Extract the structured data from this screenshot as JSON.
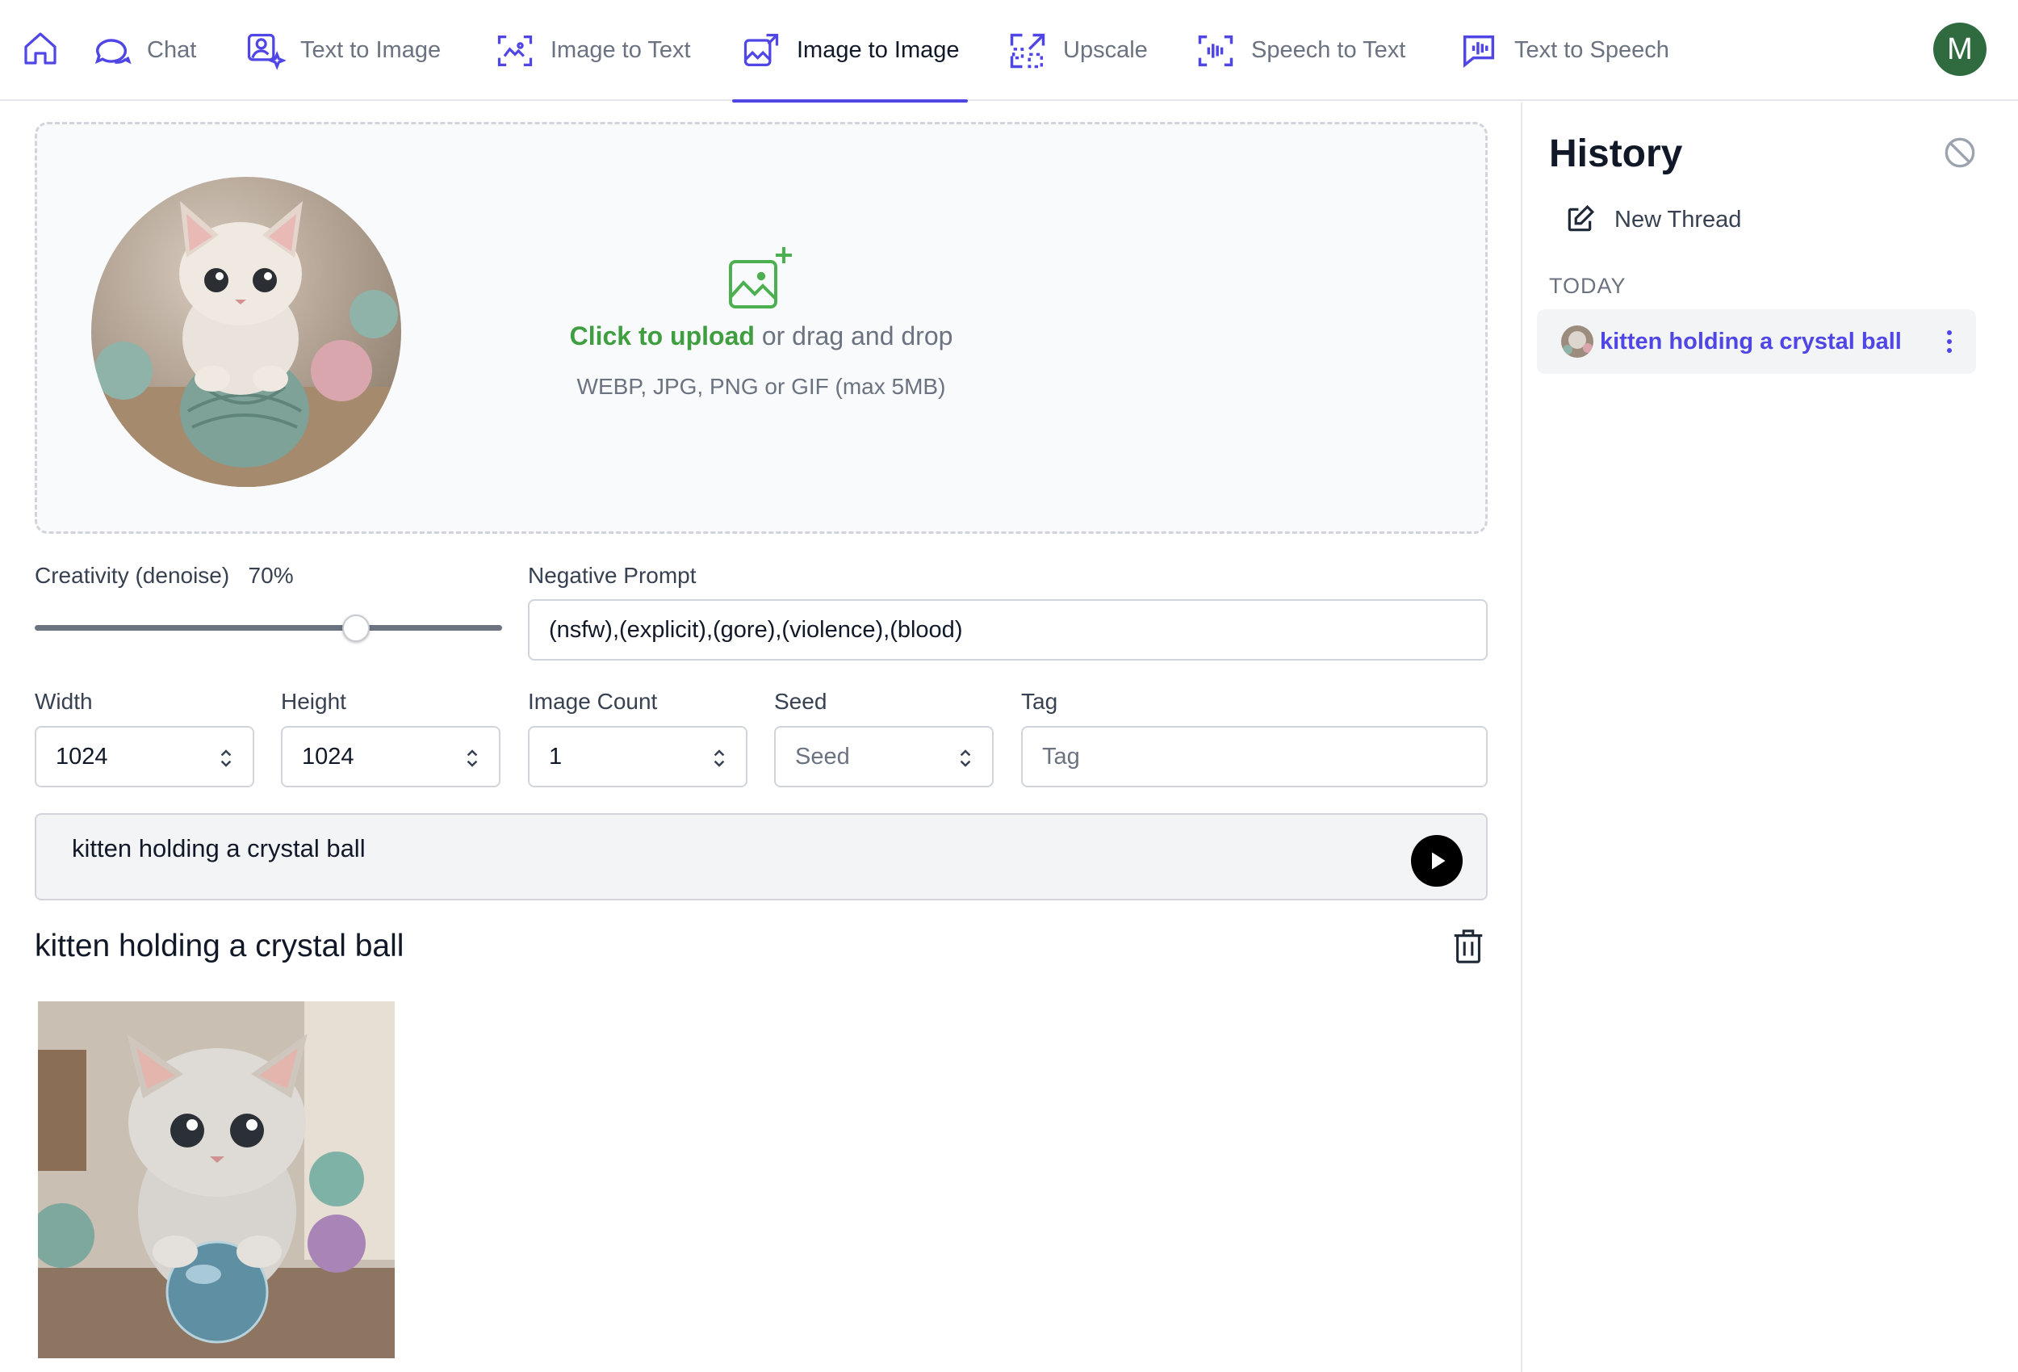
{
  "nav": {
    "tabs": [
      {
        "label": "Chat",
        "icon": "chat-icon"
      },
      {
        "label": "Text to Image",
        "icon": "text-to-image-icon"
      },
      {
        "label": "Image to Text",
        "icon": "image-to-text-icon"
      },
      {
        "label": "Image to Image",
        "icon": "image-to-image-icon",
        "active": true
      },
      {
        "label": "Upscale",
        "icon": "upscale-icon"
      },
      {
        "label": "Speech to Text",
        "icon": "speech-to-text-icon"
      },
      {
        "label": "Text to Speech",
        "icon": "text-to-speech-icon"
      }
    ],
    "avatar_initial": "M",
    "accent_color": "#4f46e5",
    "avatar_color": "#2f6b3e"
  },
  "upload": {
    "link_text": "Click to upload",
    "rest_text": " or drag and drop",
    "hint": "WEBP, JPG, PNG or GIF (max 5MB)",
    "accent_color": "#3f9e3f"
  },
  "settings": {
    "creativity_label": "Creativity (denoise)",
    "creativity_value_text": "70%",
    "creativity_value": 0.7,
    "negative_prompt_label": "Negative Prompt",
    "negative_prompt_value": "(nsfw),(explicit),(gore),(violence),(blood)",
    "width_label": "Width",
    "width_value": "1024",
    "height_label": "Height",
    "height_value": "1024",
    "image_count_label": "Image Count",
    "image_count_value": "1",
    "seed_label": "Seed",
    "seed_placeholder": "Seed",
    "tag_label": "Tag",
    "tag_placeholder": "Tag"
  },
  "prompt": {
    "text": "kitten holding a crystal ball"
  },
  "result": {
    "title": "kitten holding a crystal ball"
  },
  "sidebar": {
    "title": "History",
    "new_thread_label": "New Thread",
    "section_label": "TODAY",
    "items": [
      {
        "label": "kitten holding a crystal ball"
      }
    ]
  }
}
